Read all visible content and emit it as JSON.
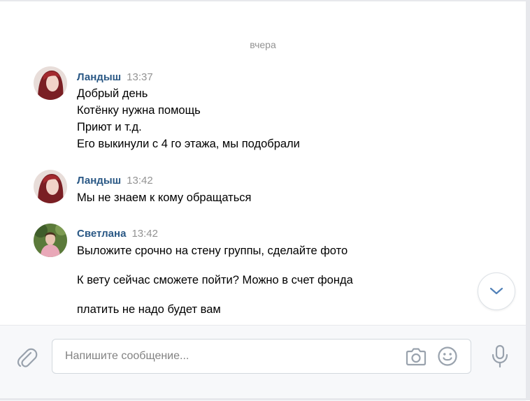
{
  "history": {
    "date_separator": "вчера",
    "messages": [
      {
        "author": "Ландыш",
        "time": "13:37",
        "lines": [
          "Добрый день",
          "Котёнку нужна помощь",
          "Приют и т.д.",
          "Его выкинули с 4 го этажа, мы подобрали"
        ]
      },
      {
        "author": "Ландыш",
        "time": "13:42",
        "lines": [
          "Мы не знаем к кому обращаться"
        ]
      },
      {
        "author": "Светлана",
        "time": "13:42",
        "lines": [
          "Выложите срочно на стену группы, сделайте фото",
          "К вету сейчас сможете пойти? Можно в счет фонда",
          "платить не надо будет вам"
        ]
      }
    ]
  },
  "composer": {
    "placeholder": "Напишите сообщение...",
    "value": "",
    "icons": {
      "attach": "paperclip-icon",
      "camera": "camera-icon",
      "emoji": "smile-icon",
      "voice": "microphone-icon",
      "scroll": "chevron-down-icon"
    }
  },
  "colors": {
    "author": "#2a5885",
    "time": "#939393",
    "icon": "#99a2ad",
    "scroll_chevron": "#5181b8",
    "composer_bg": "#f7f8fa"
  }
}
